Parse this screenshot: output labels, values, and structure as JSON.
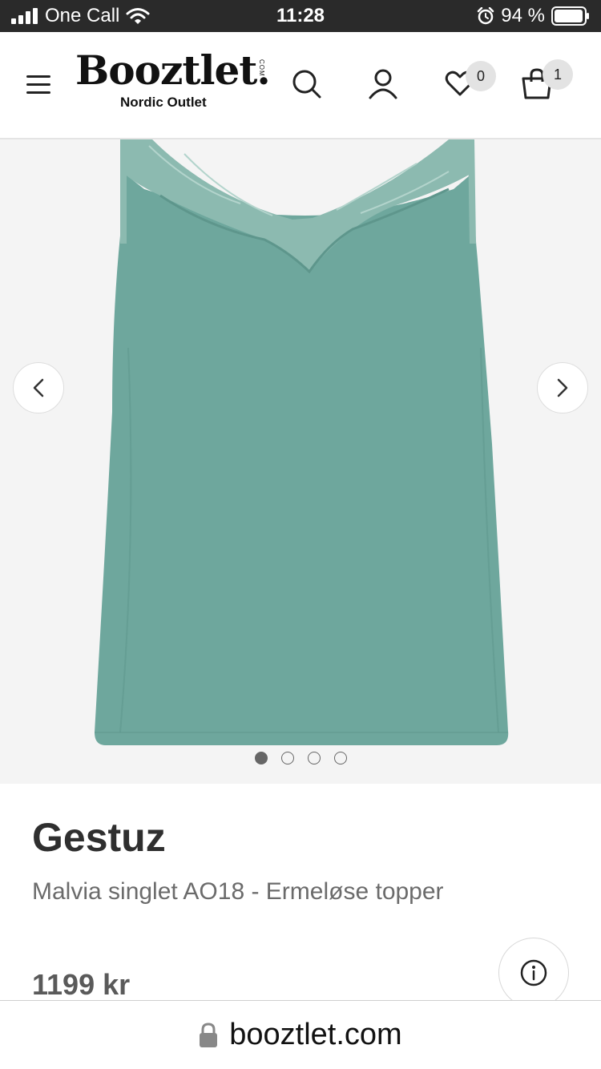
{
  "status_bar": {
    "carrier": "One Call",
    "time": "11:28",
    "battery": "94 %"
  },
  "header": {
    "logo_text": "Booztlet.",
    "logo_com": "COM",
    "logo_subtitle": "Nordic Outlet",
    "wishlist_count": "0",
    "cart_count": "1",
    "icons": [
      "menu-icon",
      "search-icon",
      "account-icon",
      "heart-icon",
      "bag-icon"
    ]
  },
  "gallery": {
    "image_count": 4,
    "active_index": 0,
    "prev_icon": "chevron-left-icon",
    "next_icon": "chevron-right-icon"
  },
  "product": {
    "brand": "Gestuz",
    "title": "Malvia singlet AO18 - Ermeløse topper",
    "price": "1199 kr",
    "info_icon": "info-icon"
  },
  "url_bar": {
    "url": "booztlet.com",
    "lock_icon": "lock-icon"
  },
  "colors": {
    "status_bar_bg": "#2a2a2a",
    "gallery_bg": "#f4f4f4",
    "product_color": "#6ea79d",
    "badge_bg": "#e3e3e3"
  }
}
